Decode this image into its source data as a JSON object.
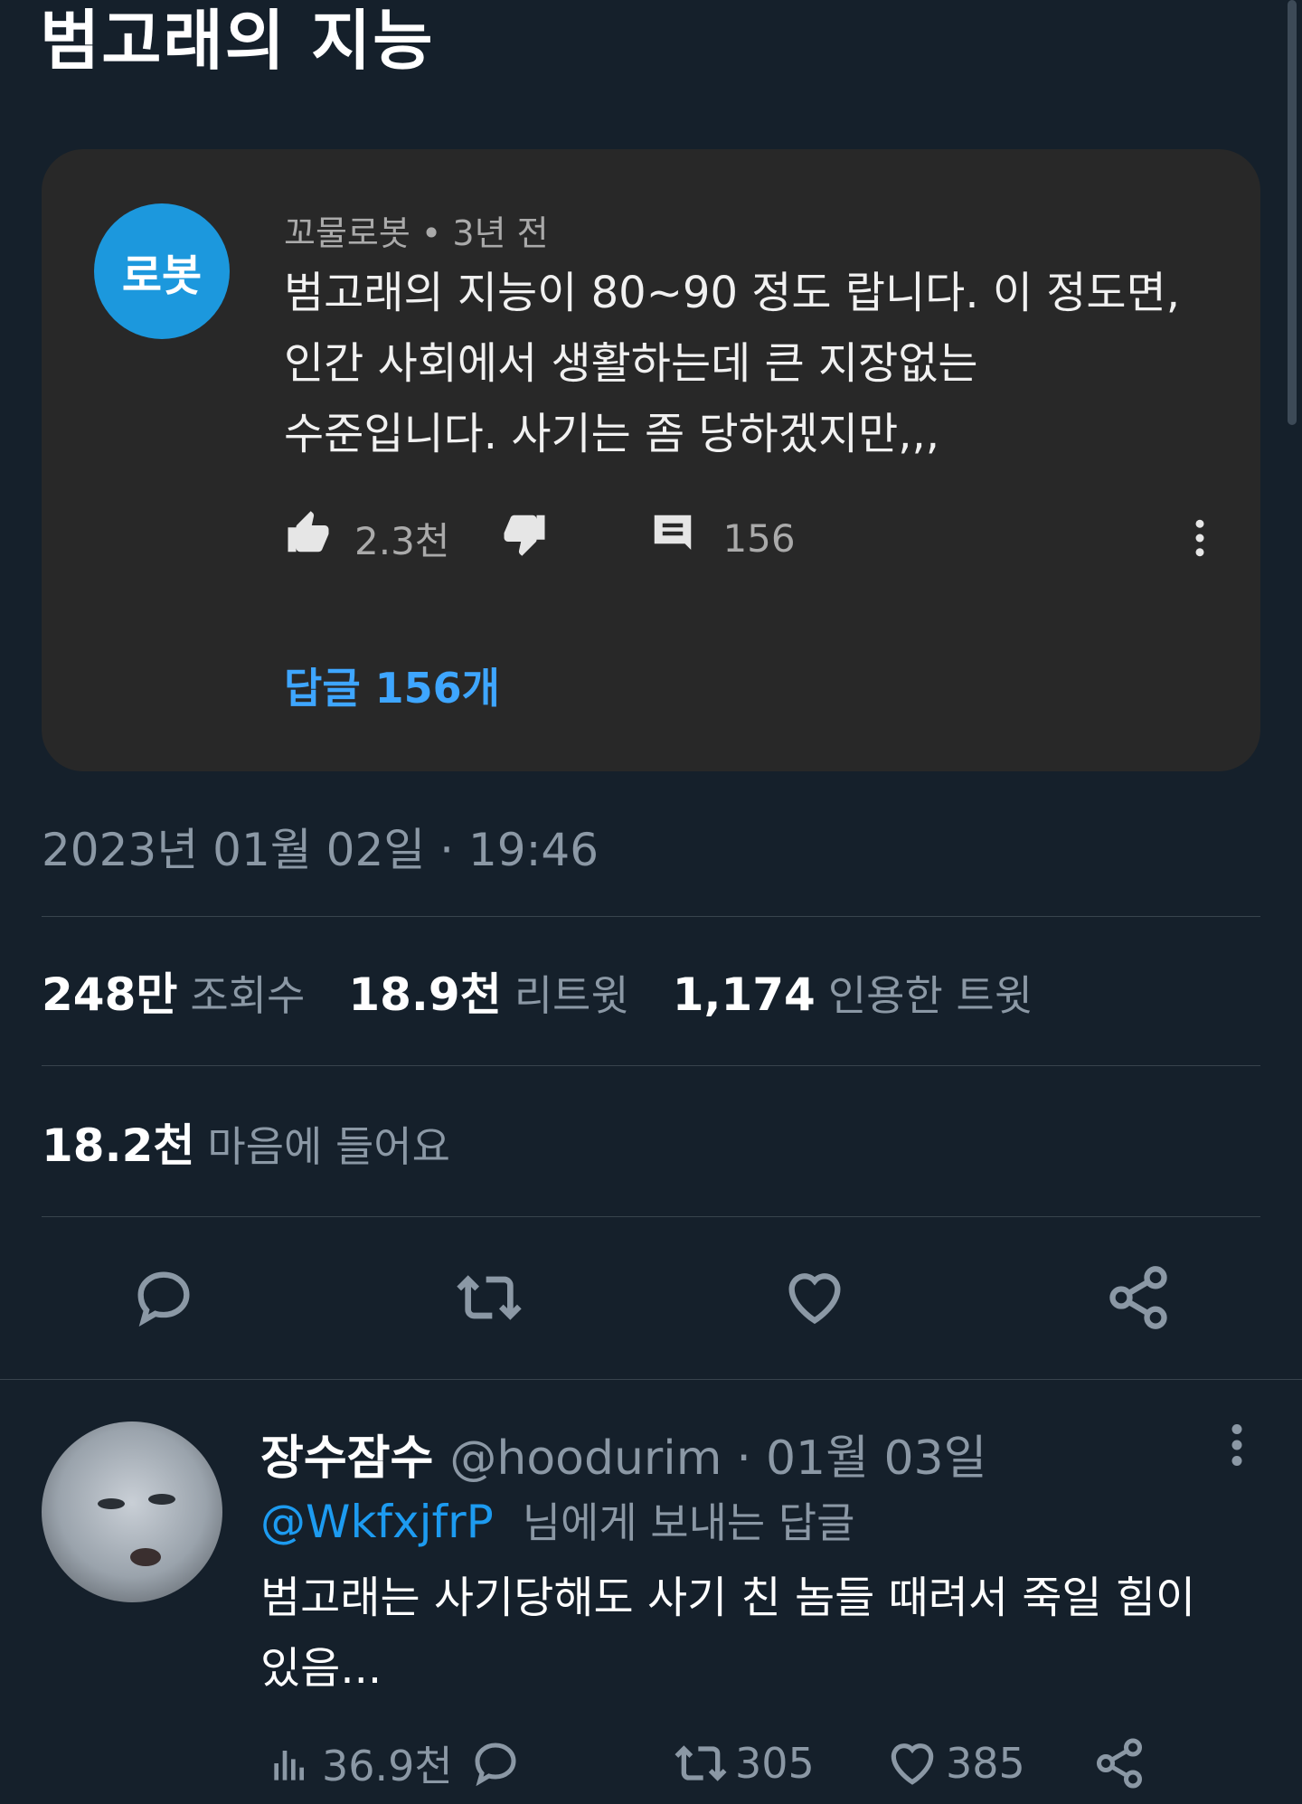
{
  "title": "범고래의 지능",
  "yt_comment": {
    "avatar_text": "로봇",
    "meta": "꼬물로봇 • 3년 전",
    "text_lines": [
      "범고래의 지능이 80~90 정도 랍니다.  이 정도면,",
      "인간 사회에서 생활하는데 큰 지장없는",
      "수준입니다.  사기는 좀 당하겠지만,,,"
    ],
    "likes": "2.3천",
    "reply_count": "156",
    "reply_link": "답글 156개",
    "icons": [
      "thumbs-up-icon",
      "thumbs-down-icon",
      "comment-icon",
      "more-vertical-icon"
    ]
  },
  "tweet": {
    "timestamp": "2023년 01월 02일 · 19:46",
    "views_num": "248만",
    "views_label": "조회수",
    "retweets_num": "18.9천",
    "retweets_label": "리트윗",
    "quotes_num": "1,174",
    "quotes_label": "인용한 트윗",
    "likes_num": "18.2천",
    "likes_label": "마음에 들어요",
    "actions": [
      "reply-icon",
      "retweet-icon",
      "like-icon",
      "share-icon"
    ]
  },
  "reply": {
    "name": "장수잠수",
    "handle": "@hoodurim",
    "separator": "·",
    "date": "01월 03일",
    "mention": "@WkfxjfrP",
    "to_text": "님에게 보내는 답글",
    "text_lines": [
      "범고래는 사기당해도 사기 친 놈들 때려서 죽일 힘이",
      "있음..."
    ],
    "views": "36.9천",
    "retweets": "305",
    "likes": "385"
  },
  "colors": {
    "background": "#15202b",
    "card": "#282828",
    "youtube_link": "#3ea6ff",
    "twitter_blue": "#1d9bf0",
    "muted": "#8b98a5",
    "avatar_blue": "#1c98dd"
  }
}
